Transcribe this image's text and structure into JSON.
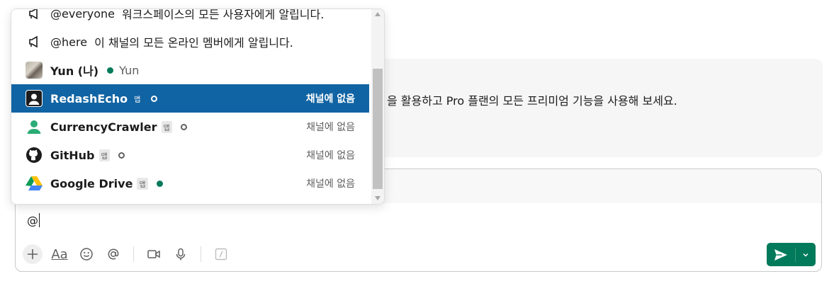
{
  "banner": {
    "text": "을 활용하고 Pro 플랜의 모든 프리미엄 기능을 사용해 보세요."
  },
  "composer": {
    "input_value": "@"
  },
  "mention_list": {
    "items": [
      {
        "type": "broadcast",
        "name": "@everyone",
        "description": "워크스페이스의 모든 사용자에게 알립니다."
      },
      {
        "type": "broadcast",
        "name": "@here",
        "description": "이 채널의 모든 온라인 멤버에게 알립니다."
      },
      {
        "type": "user",
        "name": "Yun (나)",
        "status": "active",
        "subtitle": "Yun",
        "avatar": "user-photo"
      },
      {
        "type": "app",
        "name": "RedashEcho",
        "badge": "앱",
        "status": "away",
        "right": "채널에 없음",
        "selected": true,
        "avatar": "person-silhouette-icon"
      },
      {
        "type": "app",
        "name": "CurrencyCrawler",
        "badge": "앱",
        "status": "away",
        "right": "채널에 없음",
        "avatar": "person-icon"
      },
      {
        "type": "app",
        "name": "GitHub",
        "badge": "앱",
        "status": "away",
        "right": "채널에 없음",
        "avatar": "github-icon"
      },
      {
        "type": "app",
        "name": "Google Drive",
        "badge": "앱",
        "status": "active",
        "right": "채널에 없음",
        "avatar": "google-drive-icon"
      }
    ]
  },
  "colors": {
    "selected_bg": "#1164a3",
    "active_dot": "#007a5a",
    "send_button": "#007a5a"
  }
}
